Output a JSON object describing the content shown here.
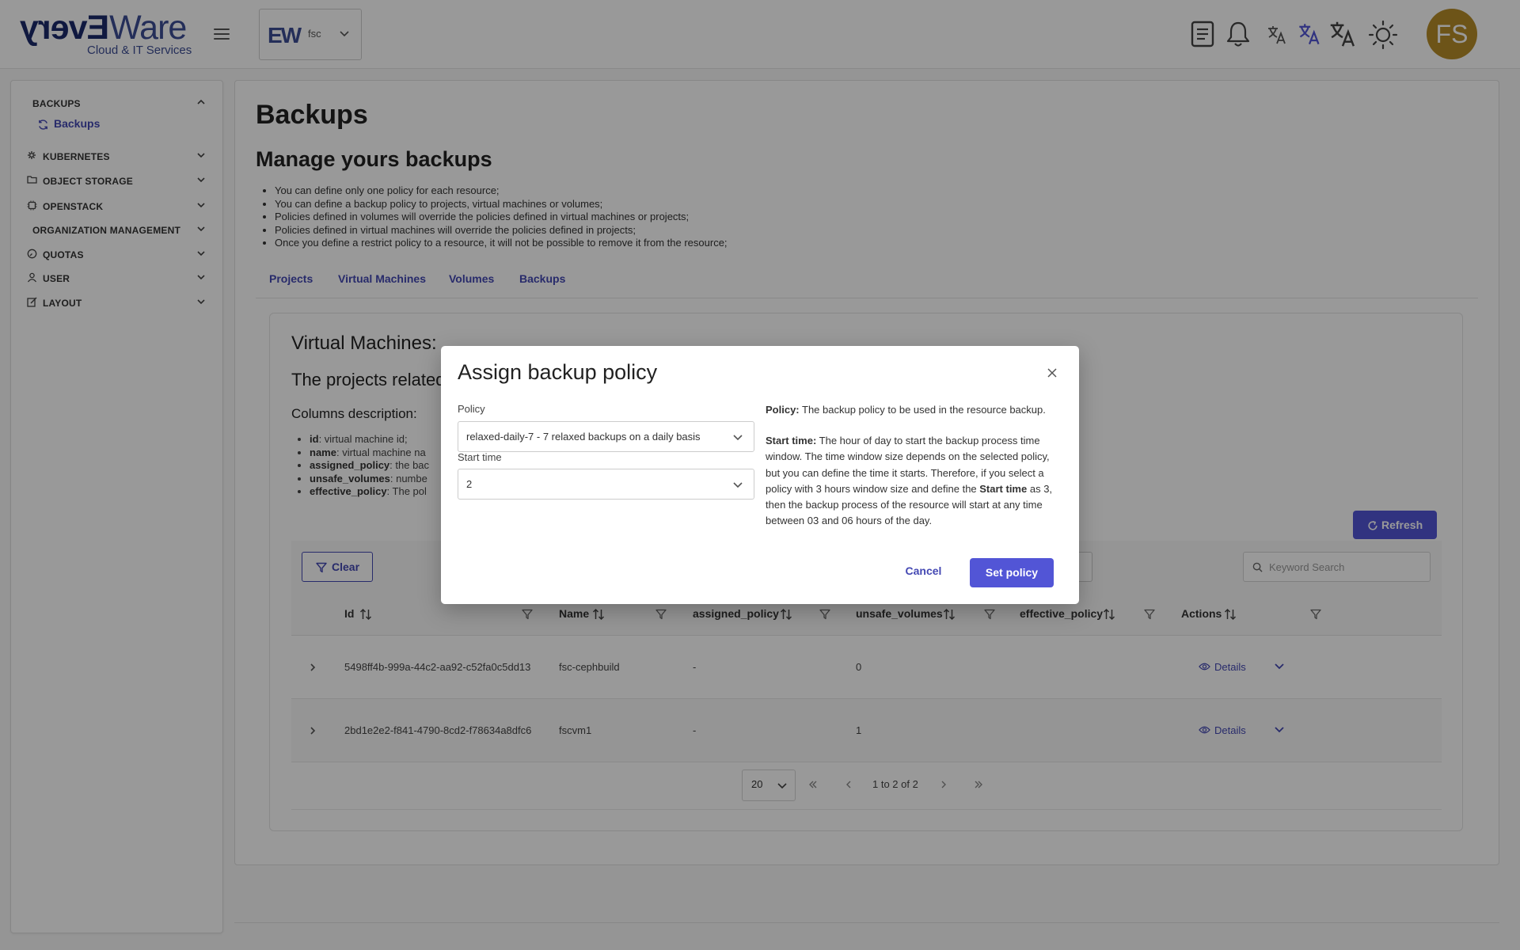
{
  "header": {
    "logo_prefix": "Every",
    "logo_suffix": "Ware",
    "logo_tagline": "Cloud & IT Services",
    "tenant_logo": "EW",
    "tenant_name": "fsc",
    "avatar_initials": "FS",
    "icons": [
      "menu-icon",
      "notes-icon",
      "bell-icon",
      "translate-icon",
      "translate-active-icon",
      "translate-large-icon",
      "sun-icon"
    ]
  },
  "sidebar": {
    "sections": [
      {
        "label": "BACKUPS",
        "icon": "none",
        "expanded": true
      },
      {
        "label": "KUBERNETES",
        "icon": "kubernetes-icon",
        "expanded": false
      },
      {
        "label": "OBJECT STORAGE",
        "icon": "folder-icon",
        "expanded": false
      },
      {
        "label": "OPENSTACK",
        "icon": "chip-icon",
        "expanded": false
      },
      {
        "label": "ORGANIZATION MANAGEMENT",
        "icon": "none",
        "expanded": false
      },
      {
        "label": "QUOTAS",
        "icon": "gauge-icon",
        "expanded": false
      },
      {
        "label": "USER",
        "icon": "user-icon",
        "expanded": false
      },
      {
        "label": "LAYOUT",
        "icon": "edit-icon",
        "expanded": false
      }
    ],
    "backups_items": [
      {
        "label": "Backups",
        "icon": "refresh-icon",
        "active": true
      }
    ]
  },
  "page": {
    "title": "Backups",
    "subtitle": "Manage yours backups",
    "rules": [
      "You can define only one policy for each resource;",
      "You can define a backup policy to projects, virtual machines or volumes;",
      "Policies defined in volumes will override the policies defined in virtual machines or projects;",
      "Policies defined in virtual machines will override the policies defined in projects;",
      "Once you define a restrict policy to a resource, it will not be possible to remove it from the resource;"
    ],
    "tabs": [
      "Projects",
      "Virtual Machines",
      "Volumes",
      "Backups"
    ]
  },
  "vm_section": {
    "title": "Virtual Machines:",
    "subtitle_visible": "The projects related v",
    "columns_title": "Columns description:",
    "columns": [
      {
        "key": "id",
        "desc_visible": ": virtual machine id;"
      },
      {
        "key": "name",
        "desc_visible": ": virtual machine na"
      },
      {
        "key": "assigned_policy",
        "desc_visible": ": the bac"
      },
      {
        "key": "unsafe_volumes",
        "desc_visible": ": numbe"
      },
      {
        "key": "effective_policy",
        "desc_visible": ": The pol"
      }
    ],
    "refresh_label": "Refresh",
    "clear_label": "Clear",
    "search_placeholder": "Keyword Search"
  },
  "table": {
    "headers": [
      "Id",
      "Name",
      "assigned_policy",
      "unsafe_volumes",
      "effective_policy",
      "Actions"
    ],
    "rows": [
      {
        "id": "5498ff4b-999a-44c2-aa92-c52fa0c5dd13",
        "name": "fsc-cephbuild",
        "assigned_policy": "-",
        "unsafe_volumes": "0",
        "effective_policy": "",
        "action": "Details"
      },
      {
        "id": "2bd1e2e2-f841-4790-8cd2-f78634a8dfc6",
        "name": "fscvm1",
        "assigned_policy": "-",
        "unsafe_volumes": "1",
        "effective_policy": "",
        "action": "Details"
      }
    ]
  },
  "pagination": {
    "page_size": "20",
    "info": "1 to 2 of 2"
  },
  "dialog": {
    "title": "Assign backup policy",
    "policy_label": "Policy",
    "policy_value": "relaxed-daily-7 - 7 relaxed backups on a daily basis",
    "start_time_label": "Start time",
    "start_time_value": "2",
    "help_policy_term": "Policy:",
    "help_policy_text": " The backup policy to be used in the resource backup.",
    "help_start_term": "Start time:",
    "help_start_text_1": " The hour of day to start the backup process time window. The time window size depends on the selected policy, but you can define the time it starts. Therefore, if you select a policy with 3 hours window size and define the ",
    "help_start_term_inline": "Start time",
    "help_start_text_2": " as 3, then the backup process of the resource will start at any time between 03 and 06 hours of the day.",
    "cancel_label": "Cancel",
    "submit_label": "Set policy"
  },
  "colors": {
    "accent": "#5255d6",
    "link": "#4448b3",
    "avatar_bg": "#b68c28",
    "brand_dark": "#1b2a6b"
  }
}
